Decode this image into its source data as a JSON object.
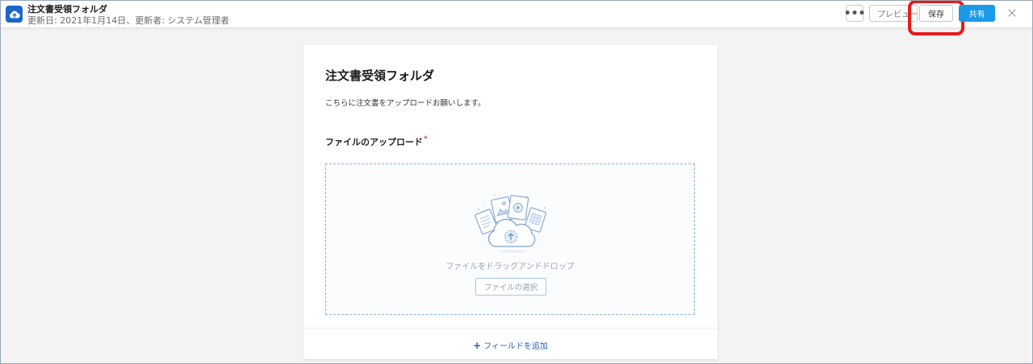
{
  "header": {
    "title": "注文書受領フォルダ",
    "subtitle": "更新日: 2021年1月14日、更新者: システム管理者",
    "app_icon": "cloud-upload-icon",
    "more_label": "•••",
    "preview_label": "プレビュー",
    "save_label": "保存",
    "share_label": "共有",
    "close_icon": "close-icon"
  },
  "form": {
    "title": "注文書受領フォルダ",
    "description": "こちらに注文書をアップロードお願いします。",
    "field_label": "ファイルのアップロード",
    "required_mark": "*",
    "dropzone": {
      "text": "ファイルをドラッグアンドドロップ",
      "select_button": "ファイルの選択",
      "illustration_icon": "cloud-files-upload-icon"
    },
    "add_field": {
      "plus": "+",
      "label": "フィールドを追加"
    }
  },
  "colors": {
    "accent": "#1a9ae8",
    "app_icon_bg": "#1b66c9",
    "highlight": "#ea1a1a",
    "link": "#2b63b2",
    "required": "#e0454a"
  }
}
